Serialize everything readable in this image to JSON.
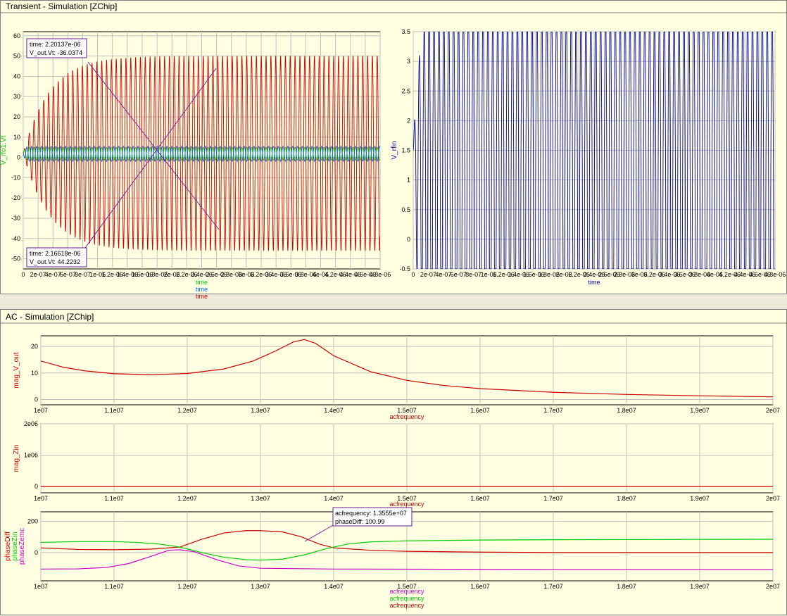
{
  "panels": {
    "transient": {
      "title": "Transient - Simulation [ZChip]"
    },
    "ac": {
      "title": "AC - Simulation [ZChip]"
    }
  },
  "markers": {
    "m1": {
      "line1": "time: 2.20137e-06",
      "line2": "V_out.Vt: -36.0374"
    },
    "m2": {
      "line1": "time: 2.16618e-06",
      "line2": "V_out.Vt: 44.2232"
    },
    "m3": {
      "line1": "acfrequency: 1.3555e+07",
      "line2": "phaseDiff: 100.99"
    }
  },
  "colors": {
    "panel_bg": "#ffffe1",
    "grid": "#c0c0c0",
    "red": "#cc0000",
    "green": "#00cc00",
    "blue": "#0000aa",
    "mid_blue": "#0066ff",
    "magenta": "#cc00cc",
    "marker_border": "#6a1b9a"
  },
  "chart_data": [
    {
      "id": "t1",
      "type": "line",
      "xlim": [
        0,
        4.8e-06
      ],
      "ylim": [
        -55,
        62
      ],
      "xticks": [
        0,
        2e-07,
        4e-07,
        6e-07,
        8e-07,
        1e-06,
        1.2e-06,
        1.4e-06,
        1.6e-06,
        1.8e-06,
        2e-06,
        2.2e-06,
        2.4e-06,
        2.6e-06,
        2.8e-06,
        3e-06,
        3.2e-06,
        3.4e-06,
        3.6e-06,
        3.8e-06,
        4e-06,
        4.2e-06,
        4.4e-06,
        4.6e-06,
        4.8e-06
      ],
      "xtick_labels": [
        "0",
        "2e-07",
        "4e-07",
        "6e-07",
        "8e-07",
        "1e-06",
        "1.2e-06",
        "1.4e-06",
        "1.6e-06",
        "1.8e-06",
        "2e-06",
        "2.2e-06",
        "2.4e-06",
        "2.6e-06",
        "2.8e-06",
        "3e-06",
        "3.2e-06",
        "3.4e-06",
        "3.6e-06",
        "3.8e-06",
        "4e-06",
        "4.2e-06",
        "4.4e-06",
        "4.6e-06",
        "4.8e-06"
      ],
      "yticks": [
        -50,
        -40,
        -30,
        -20,
        -10,
        0,
        10,
        20,
        30,
        40,
        50,
        60
      ],
      "ylabels": [
        {
          "text": "V_rfo1.Vt",
          "color": "#00cc00"
        }
      ],
      "xlabels": [
        {
          "text": "time",
          "color": "#00cc00"
        },
        {
          "text": "time",
          "color": "#0066ff"
        },
        {
          "text": "time",
          "color": "#cc0000"
        }
      ],
      "series": [
        {
          "color": "#cc0000",
          "kind": "osc",
          "period": 6.5e-08,
          "max_pos": 50,
          "max_neg": 46,
          "tau": 3.5e-07,
          "offset": 2
        },
        {
          "color": "#00cc00",
          "kind": "osc",
          "period": 6.5e-08,
          "max_pos": 5,
          "max_neg": 1.5,
          "tau": 2e-08,
          "offset": 2
        },
        {
          "color": "#0066ff",
          "kind": "osc",
          "period": 6.5e-08,
          "max_pos": 5.5,
          "max_neg": 2,
          "tau": 2e-08,
          "offset": 2,
          "phase": 0.5
        }
      ]
    },
    {
      "id": "t2",
      "type": "line",
      "xlim": [
        0,
        4.8e-06
      ],
      "ylim": [
        -0.5,
        3.5
      ],
      "xticks": [
        0,
        2e-07,
        4e-07,
        6e-07,
        8e-07,
        1e-06,
        1.2e-06,
        1.4e-06,
        1.6e-06,
        1.8e-06,
        2e-06,
        2.2e-06,
        2.4e-06,
        2.6e-06,
        2.8e-06,
        3e-06,
        3.2e-06,
        3.4e-06,
        3.6e-06,
        3.8e-06,
        4e-06,
        4.2e-06,
        4.4e-06,
        4.6e-06,
        4.8e-06
      ],
      "xtick_labels": [
        "0",
        "2e-07",
        "4e-07",
        "6e-07",
        "8e-07",
        "1e-06",
        "1.2e-06",
        "1.4e-06",
        "1.6e-06",
        "1.8e-06",
        "2e-06",
        "2.2e-06",
        "2.4e-06",
        "2.6e-06",
        "2.8e-06",
        "3e-06",
        "3.2e-06",
        "3.4e-06",
        "3.6e-06",
        "3.8e-06",
        "4e-06",
        "4.2e-06",
        "4.4e-06",
        "4.6e-06",
        "4.8e-06"
      ],
      "yticks": [
        -0.5,
        0,
        0.5,
        1,
        1.5,
        2,
        2.5,
        3,
        3.5
      ],
      "ylabels": [
        {
          "text": "V_rfin",
          "color": "#0000aa"
        }
      ],
      "xlabels": [
        {
          "text": "time",
          "color": "#0000aa"
        }
      ],
      "series": [
        {
          "color": "#0000aa",
          "kind": "osc",
          "period": 6.5e-08,
          "max_pos": 4,
          "max_neg": 3,
          "tau": 8e-08,
          "offset": 1.5,
          "clip": true
        }
      ]
    },
    {
      "id": "a1",
      "type": "line",
      "xlim": [
        10000000,
        20000000
      ],
      "ylim": [
        -2,
        24
      ],
      "xticks": [
        10000000,
        11000000,
        12000000,
        13000000,
        14000000,
        15000000,
        16000000,
        17000000,
        18000000,
        19000000,
        20000000
      ],
      "xtick_labels": [
        "1e07",
        "1.1e07",
        "1.2e07",
        "1.3e07",
        "1.4e07",
        "1.5e07",
        "1.6e07",
        "1.7e07",
        "1.8e07",
        "1.9e07",
        "2e07"
      ],
      "yticks": [
        0,
        10,
        20
      ],
      "ylabels": [
        {
          "text": "mag_V_out",
          "color": "#cc0000"
        }
      ],
      "xlabels": [
        {
          "text": "acfrequency",
          "color": "#cc0000"
        }
      ],
      "series": [
        {
          "color": "#cc0000",
          "x": [
            10000000,
            10300000,
            10600000,
            11000000,
            11500000,
            12000000,
            12500000,
            12900000,
            13200000,
            13450000,
            13600000,
            13750000,
            14000000,
            14500000,
            15000000,
            15500000,
            16000000,
            17000000,
            18000000,
            19000000,
            20000000
          ],
          "y": [
            14.5,
            12.2,
            10.8,
            9.7,
            9.3,
            9.8,
            11.5,
            14.5,
            18.2,
            21.7,
            22.6,
            21.2,
            16.5,
            10.5,
            7.2,
            5.3,
            4.1,
            2.7,
            1.9,
            1.4,
            1.0
          ]
        }
      ]
    },
    {
      "id": "a2",
      "type": "line",
      "xlim": [
        10000000,
        20000000
      ],
      "ylim": [
        -200000,
        2000000
      ],
      "xticks": [
        10000000,
        11000000,
        12000000,
        13000000,
        14000000,
        15000000,
        16000000,
        17000000,
        18000000,
        19000000,
        20000000
      ],
      "xtick_labels": [
        "1e07",
        "1.1e07",
        "1.2e07",
        "1.3e07",
        "1.4e07",
        "1.5e07",
        "1.6e07",
        "1.7e07",
        "1.8e07",
        "1.9e07",
        "2e07"
      ],
      "yticks": [
        0,
        1000000,
        2000000
      ],
      "ytick_labels": [
        "0",
        "1e06",
        "2e06"
      ],
      "ylabels": [
        {
          "text": "mag_Zin",
          "color": "#cc0000"
        }
      ],
      "xlabels": [
        {
          "text": "acfrequency",
          "color": "#cc0000"
        }
      ],
      "series": [
        {
          "color": "#cc0000",
          "x": [
            10000000,
            20000000
          ],
          "y": [
            0,
            0
          ]
        }
      ]
    },
    {
      "id": "a3",
      "type": "line",
      "xlim": [
        10000000,
        20000000
      ],
      "ylim": [
        -180,
        260
      ],
      "xticks": [
        10000000,
        11000000,
        12000000,
        13000000,
        14000000,
        15000000,
        16000000,
        17000000,
        18000000,
        19000000,
        20000000
      ],
      "xtick_labels": [
        "1e07",
        "1.1e07",
        "1.2e07",
        "1.3e07",
        "1.4e07",
        "1.5e07",
        "1.6e07",
        "1.7e07",
        "1.8e07",
        "1.9e07",
        "2e07"
      ],
      "yticks": [
        0,
        200
      ],
      "ylabels": [
        {
          "text": "phaseDiff",
          "color": "#cc0000"
        },
        {
          "text": "phaseZin",
          "color": "#00cc00"
        },
        {
          "text": "phaseZemc",
          "color": "#cc00cc"
        }
      ],
      "xlabels": [
        {
          "text": "acfrequency",
          "color": "#cc00cc"
        },
        {
          "text": "acfrequency",
          "color": "#00cc00"
        },
        {
          "text": "acfrequency",
          "color": "#cc0000"
        }
      ],
      "series": [
        {
          "color": "#cc0000",
          "x": [
            10000000,
            10500000,
            11000000,
            11500000,
            11900000,
            12200000,
            12500000,
            12800000,
            13000000,
            13300000,
            13555000,
            13800000,
            14000000,
            14500000,
            15000000,
            16000000,
            17000000,
            18000000,
            19000000,
            20000000
          ],
          "y": [
            30,
            20,
            18,
            22,
            35,
            85,
            125,
            140,
            140,
            132,
            100.99,
            55,
            30,
            15,
            8,
            3,
            0,
            0,
            0,
            0
          ]
        },
        {
          "color": "#00cc00",
          "x": [
            10000000,
            10500000,
            11000000,
            11300000,
            11600000,
            11900000,
            12200000,
            12500000,
            12800000,
            13000000,
            13300000,
            13600000,
            13900000,
            14200000,
            14500000,
            15000000,
            16000000,
            17000000,
            18000000,
            19000000,
            20000000
          ],
          "y": [
            65,
            70,
            70,
            65,
            55,
            35,
            0,
            -30,
            -45,
            -48,
            -42,
            -15,
            25,
            55,
            68,
            75,
            80,
            82,
            83,
            84,
            85
          ]
        },
        {
          "color": "#cc00cc",
          "x": [
            10000000,
            10500000,
            10900000,
            11200000,
            11500000,
            11750000,
            11900000,
            12100000,
            12400000,
            12700000,
            13000000,
            14000000,
            15000000,
            16000000,
            17000000,
            18000000,
            19000000,
            20000000
          ],
          "y": [
            -105,
            -104,
            -95,
            -70,
            -25,
            15,
            18,
            5,
            -45,
            -85,
            -100,
            -105,
            -106,
            -107,
            -108,
            -108,
            -108,
            -108
          ]
        }
      ]
    }
  ]
}
